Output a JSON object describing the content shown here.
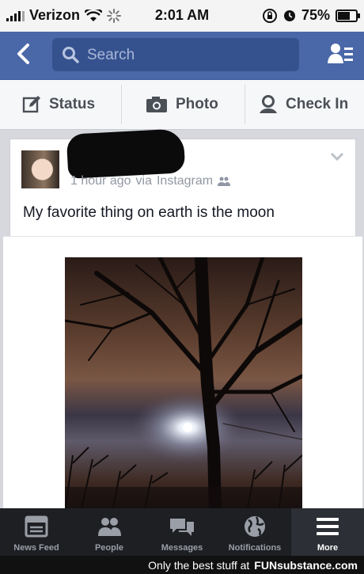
{
  "status_bar": {
    "carrier": "Verizon",
    "time": "2:01 AM",
    "battery": "75%",
    "battery_level": 0.75
  },
  "nav": {
    "search_placeholder": "Search"
  },
  "actions": {
    "status_label": "Status",
    "photo_label": "Photo",
    "checkin_label": "Check In"
  },
  "post": {
    "meta_time": "1 hour ago",
    "meta_via": "via",
    "meta_app": "Instagram",
    "text": "My favorite thing on earth is the moon"
  },
  "tabs": {
    "news_feed": "News Feed",
    "people": "People",
    "messages": "Messages",
    "notifications": "Notifications",
    "more": "More"
  },
  "footer": {
    "text": "Only the best stuff at",
    "brand": "FUNsubstance.com"
  },
  "colors": {
    "facebook_blue": "#4a68a8",
    "search_bg": "#35528f",
    "tabbar_bg": "#1d1f23"
  }
}
